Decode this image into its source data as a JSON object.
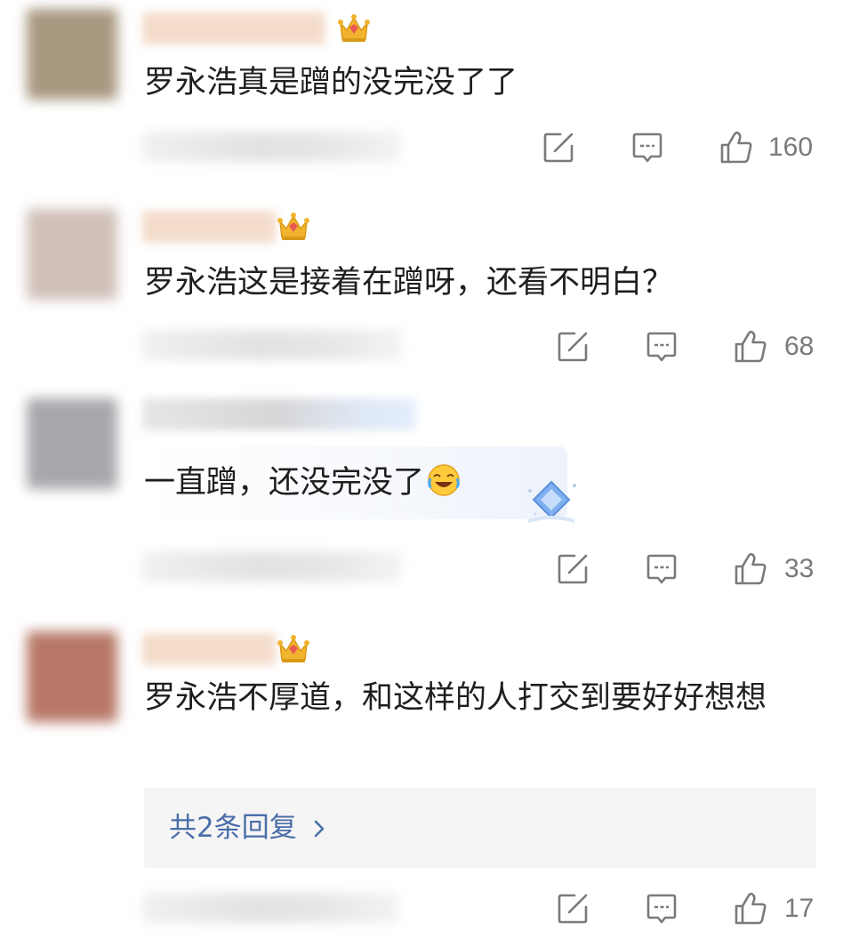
{
  "comments": [
    {
      "text": "罗永浩真是蹭的没完没了了",
      "likes": "160",
      "avatar_color": "#a89880",
      "name_color": "#f4dccb",
      "badge": "crown-badge-icon"
    },
    {
      "text": "罗永浩这是接着在蹭呀，还看不明白？",
      "likes": "68",
      "avatar_color": "#d0c0b8",
      "name_color": "#f4dccb",
      "badge": "crown-badge-icon"
    },
    {
      "text": "一直蹭，还没完没了",
      "likes": "33",
      "avatar_color": "#a8a8ac",
      "name_color": "#dcdcde",
      "emoji": "laughing-crying-emoji-icon",
      "decoration": "diamond-sparkle-icon"
    },
    {
      "text": "罗永浩不厚道，和这样的人打交到要好好想想",
      "likes": "17",
      "avatar_color": "#b87868",
      "name_color": "#f4dccb",
      "badge": "crown-badge-icon",
      "replies_label": "共2条回复"
    }
  ],
  "icons": {
    "share": "share-icon",
    "comment": "comment-icon",
    "like": "like-icon",
    "reply_chevron": "chevron-right-icon"
  },
  "colors": {
    "link": "#4a6ea8",
    "count": "#7a7a7a",
    "icon": "#7a7a7a",
    "crown": "#f2b42e",
    "crown_gem": "#e85a4f"
  }
}
